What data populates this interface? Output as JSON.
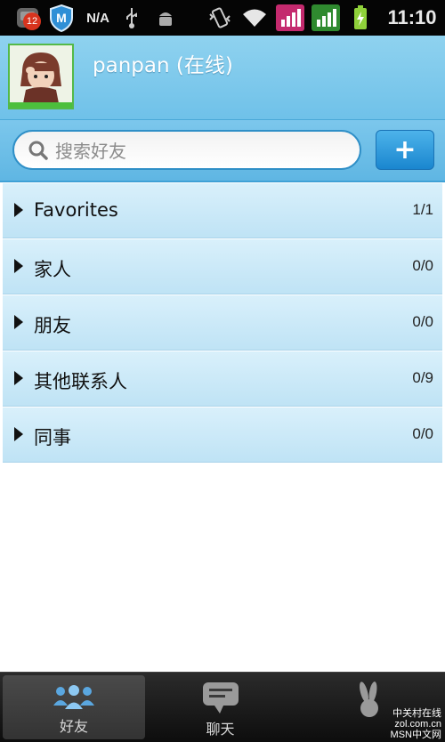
{
  "status_bar": {
    "notification_count": "12",
    "network_label": "N/A",
    "time": "11:10"
  },
  "header": {
    "username": "panpan",
    "status": "(在线)"
  },
  "search": {
    "placeholder": "搜索好友",
    "add_label": "+"
  },
  "groups": [
    {
      "label": "Favorites",
      "count": "1/1"
    },
    {
      "label": "家人",
      "count": "0/0"
    },
    {
      "label": "朋友",
      "count": "0/0"
    },
    {
      "label": "其他联系人",
      "count": "0/9"
    },
    {
      "label": "同事",
      "count": "0/0"
    }
  ],
  "tabs": [
    {
      "label": "好友",
      "icon": "friends-icon",
      "active": true
    },
    {
      "label": "聊天",
      "icon": "chat-icon",
      "active": false
    },
    {
      "label": "",
      "icon": "bunny-icon",
      "active": false
    }
  ],
  "watermark": {
    "line1": "中关村在线",
    "line2": "zol.com.cn",
    "line3": "MSN中文网"
  },
  "colors": {
    "header_blue": "#6fc1e9",
    "accent_blue": "#1a86cf",
    "online_green": "#4cbf3c"
  }
}
